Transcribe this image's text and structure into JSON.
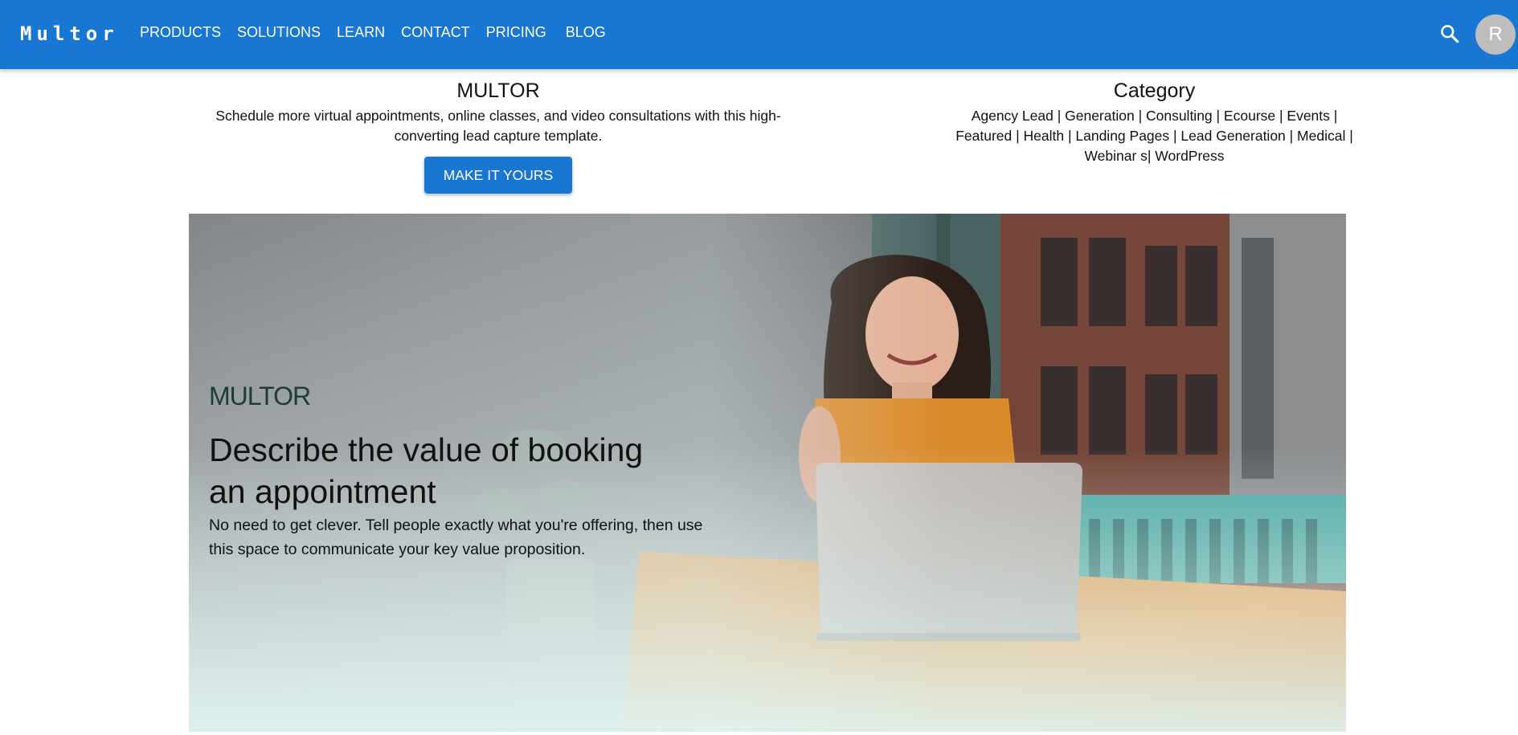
{
  "app": {
    "brand": "Multor"
  },
  "nav": {
    "items": [
      {
        "label": "PRODUCTS"
      },
      {
        "label": "SOLUTIONS"
      },
      {
        "label": "LEARN"
      },
      {
        "label": "CONTACT"
      },
      {
        "label": "PRICING"
      },
      {
        "label": "BLOG"
      }
    ]
  },
  "header": {
    "search_icon": "search-icon",
    "avatar_initial": "R"
  },
  "template": {
    "title": "MULTOR",
    "description": "Schedule more virtual appointments, online classes, and video consultations with this high-converting lead capture template.",
    "cta_label": "MAKE IT YOURS"
  },
  "category": {
    "title": "Category",
    "list": "Agency Lead | Generation | Consulting | Ecourse | Events | Featured | Health | Landing Pages | Lead Generation | Medical | Webinar s| WordPress"
  },
  "hero": {
    "logo_text": "MULTOR",
    "heading": "Describe the value of booking an appointment",
    "subtext": "No need to get clever. Tell people exactly what you're offering, then use this space to communicate your key value proposition."
  },
  "colors": {
    "primary": "#1976d2",
    "avatar_bg": "#bdbdbd",
    "text": "#111111"
  }
}
